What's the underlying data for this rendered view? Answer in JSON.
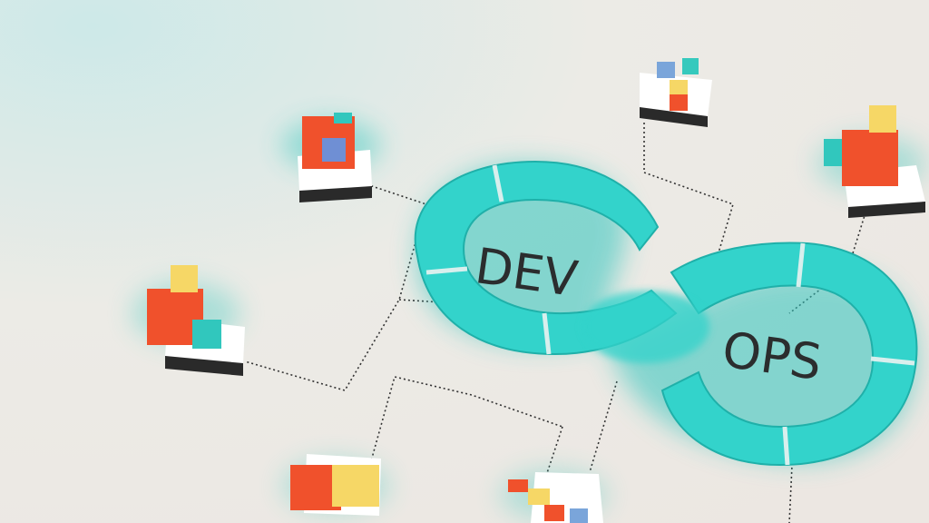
{
  "scene": {
    "word_left": "DEV",
    "word_right": "OPS"
  },
  "colors": {
    "background": "#ecebe6",
    "loop": "#33d3cb",
    "loop_shade": "#23b3ac",
    "cube_red": "#f0512c",
    "cube_yellow": "#f6d766",
    "cube_teal": "#31c7bd",
    "cube_blue": "#6f8fd4",
    "base_top": "#ffffff",
    "base_side": "#2a2a2a",
    "line": "#333333"
  }
}
